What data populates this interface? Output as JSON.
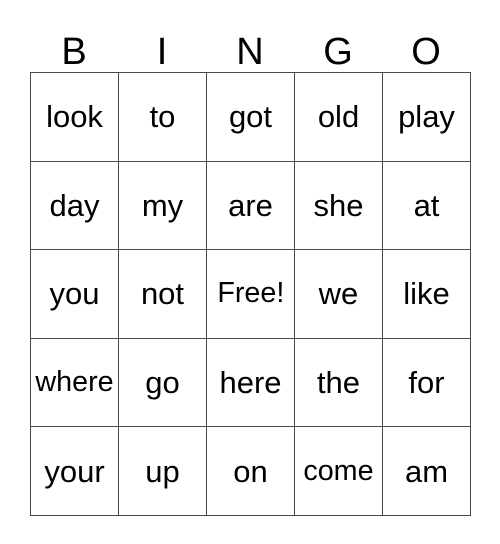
{
  "card": {
    "headers": [
      "B",
      "I",
      "N",
      "G",
      "O"
    ],
    "rows": [
      [
        "look",
        "to",
        "got",
        "old",
        "play"
      ],
      [
        "day",
        "my",
        "are",
        "she",
        "at"
      ],
      [
        "you",
        "not",
        "Free!",
        "we",
        "like"
      ],
      [
        "where",
        "go",
        "here",
        "the",
        "for"
      ],
      [
        "your",
        "up",
        "on",
        "come",
        "am"
      ]
    ],
    "free_space": {
      "row": 2,
      "col": 2,
      "label": "Free!"
    },
    "colors": {
      "background": "#ffffff",
      "text": "#000000",
      "grid_line": "#4a4a4a"
    }
  }
}
